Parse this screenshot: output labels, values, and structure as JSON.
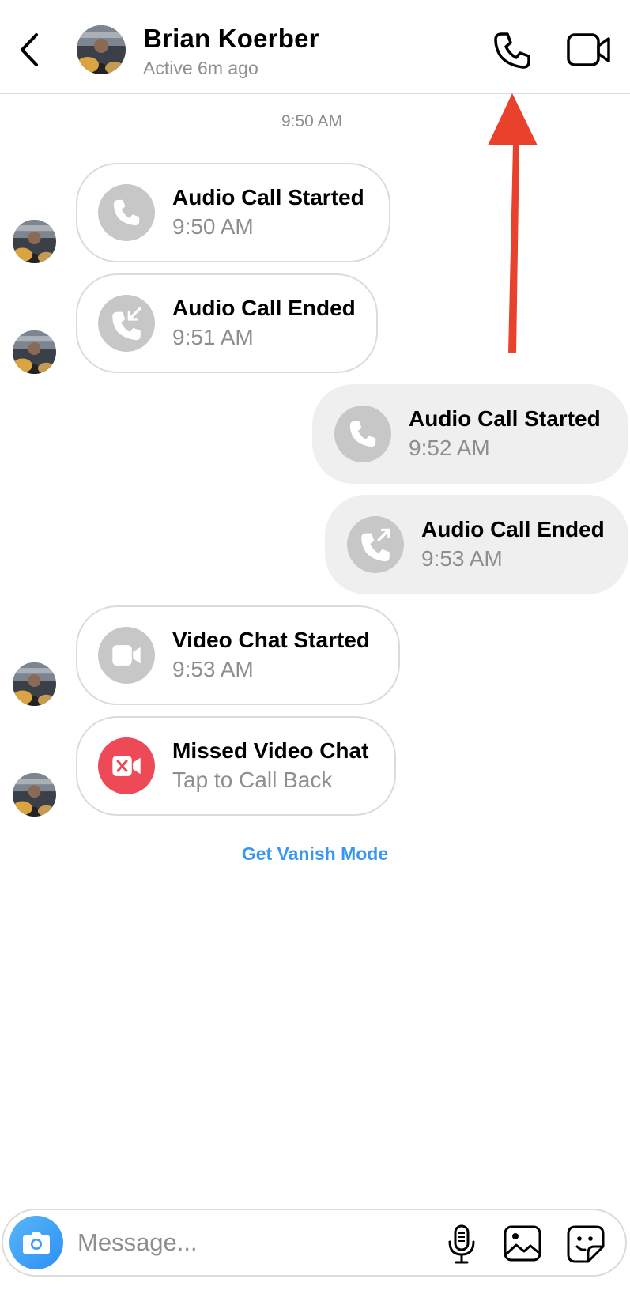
{
  "header": {
    "contact_name": "Brian Koerber",
    "status": "Active 6m ago"
  },
  "thread": {
    "timestamp_divider": "9:50 AM",
    "messages": [
      {
        "direction": "incoming",
        "title": "Audio Call Started",
        "subtitle": "9:50 AM",
        "icon": "phone-icon"
      },
      {
        "direction": "incoming",
        "title": "Audio Call Ended",
        "subtitle": "9:51 AM",
        "icon": "incoming-call-icon"
      },
      {
        "direction": "outgoing",
        "title": "Audio Call Started",
        "subtitle": "9:52 AM",
        "icon": "phone-icon"
      },
      {
        "direction": "outgoing",
        "title": "Audio Call Ended",
        "subtitle": "9:53 AM",
        "icon": "outgoing-call-icon"
      },
      {
        "direction": "incoming",
        "title": "Video Chat Started",
        "subtitle": "9:53 AM",
        "icon": "video-camera-icon"
      },
      {
        "direction": "incoming",
        "title": "Missed Video Chat",
        "subtitle": "Tap to Call Back",
        "icon": "missed-video-icon"
      }
    ],
    "vanish_mode_link": "Get Vanish Mode"
  },
  "composer": {
    "placeholder": "Message..."
  },
  "colors": {
    "accent_blue": "#3897f0",
    "missed_red": "#ed4956",
    "annotation_arrow": "#e8412c",
    "bubble_gray": "#efeff0",
    "icon_gray": "#c7c7c7"
  }
}
